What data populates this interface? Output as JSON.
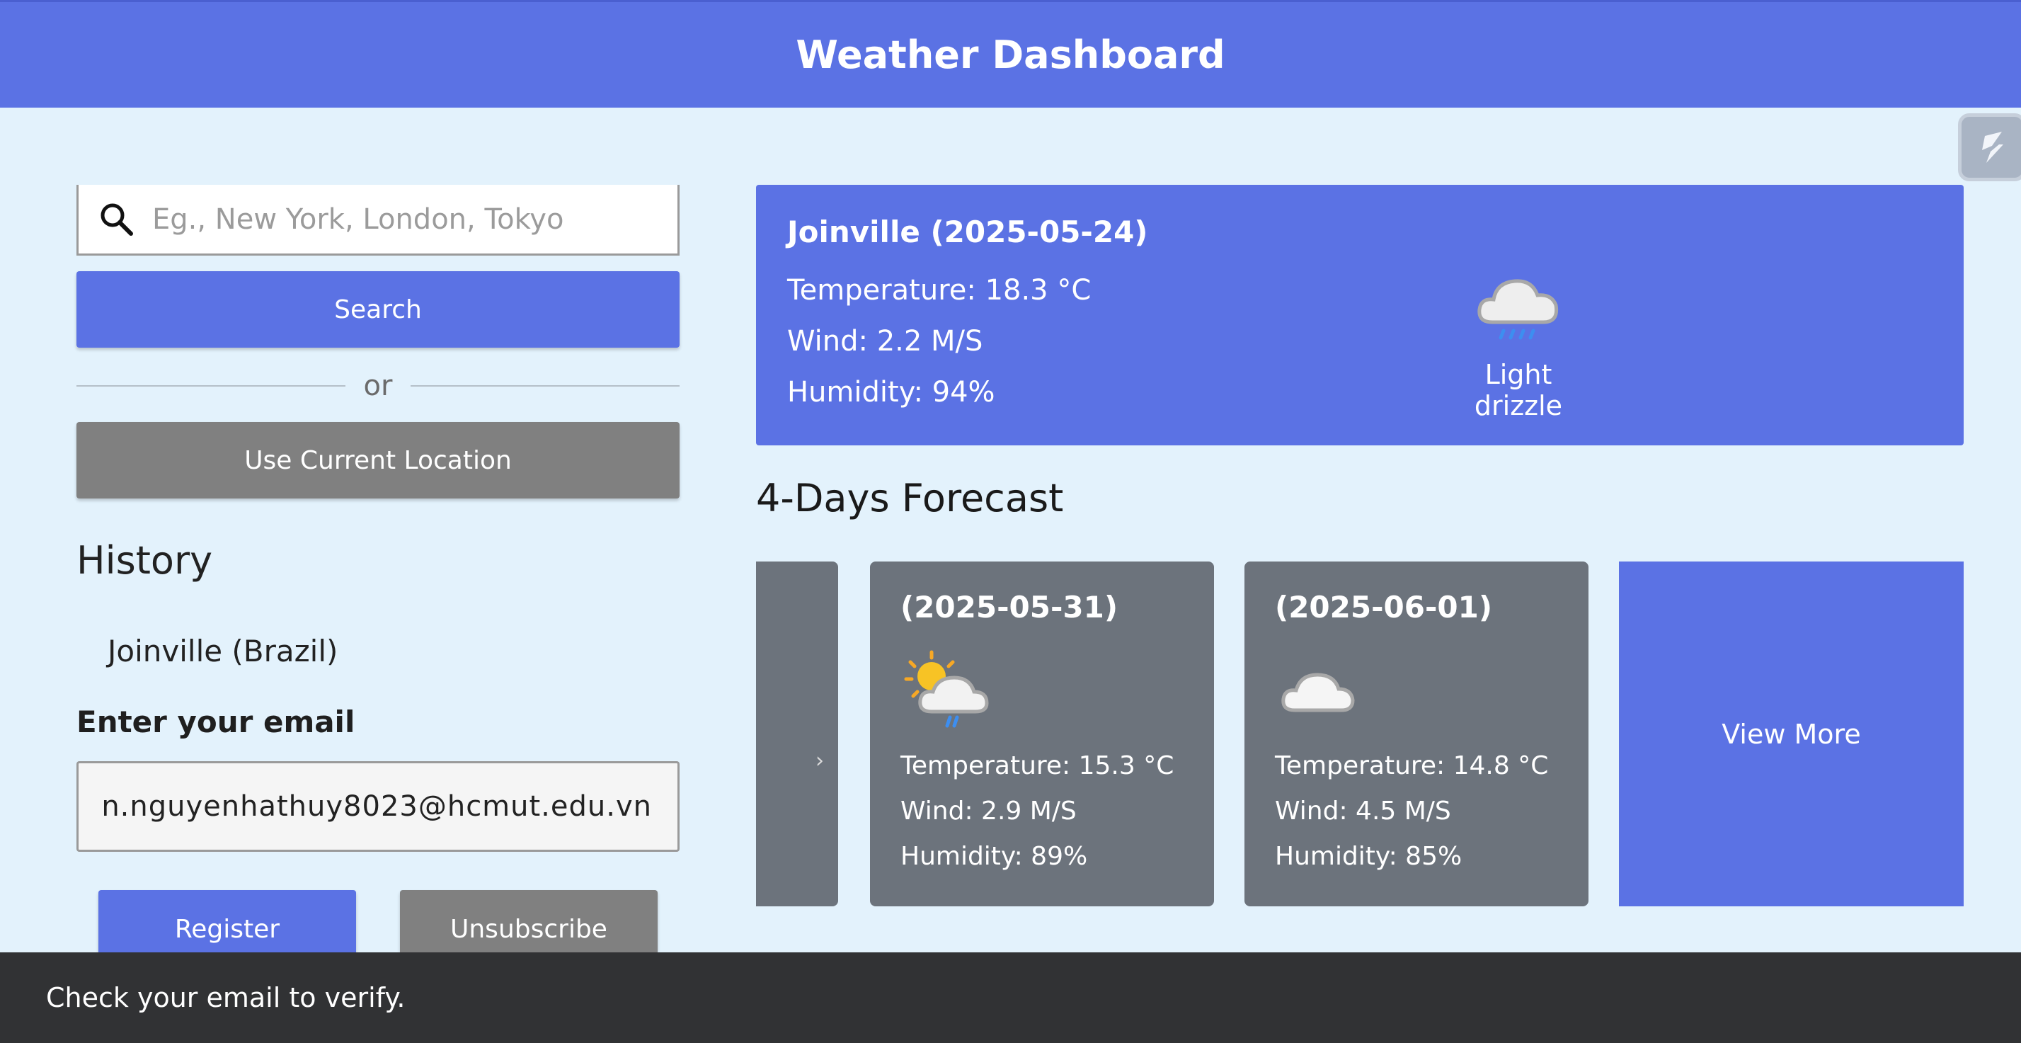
{
  "header": {
    "title": "Weather Dashboard"
  },
  "search": {
    "placeholder": "Eg., New York, London, Tokyo",
    "button_label": "Search",
    "icon": "search-icon"
  },
  "divider_label": "or",
  "location_button_label": "Use Current Location",
  "history": {
    "title": "History",
    "items": [
      {
        "label": "Joinville (Brazil)"
      }
    ]
  },
  "subscribe": {
    "label": "Enter your email",
    "email_value": "n.nguyenhathuy8023@hcmut.edu.vn",
    "register_label": "Register",
    "unsubscribe_label": "Unsubscribe"
  },
  "current": {
    "city": "Joinville (2025-05-24)",
    "temperature": "Temperature: 18.3 °C",
    "wind": "Wind: 2.2 M/S",
    "humidity": "Humidity: 94%",
    "condition": "Light drizzle",
    "condition_icon": "drizzle-cloud-icon"
  },
  "forecast": {
    "title": "4-Days Forecast",
    "days": [
      {
        "date": "(2025-05-31)",
        "icon": "sun-cloud-rain-icon",
        "temperature": "Temperature: 15.3 °C",
        "wind": "Wind: 2.9 M/S",
        "humidity": "Humidity: 89%"
      },
      {
        "date": "(2025-06-01)",
        "icon": "cloud-icon",
        "temperature": "Temperature: 14.8 °C",
        "wind": "Wind: 4.5 M/S",
        "humidity": "Humidity: 85%"
      }
    ],
    "view_more_label": "View More"
  },
  "toast": {
    "message": "Check your email to verify."
  },
  "colors": {
    "accent": "#5b72e4",
    "secondary": "#808080",
    "card_gray": "#6c737c",
    "background": "#e3f2fc",
    "toast_bg": "#313234"
  }
}
